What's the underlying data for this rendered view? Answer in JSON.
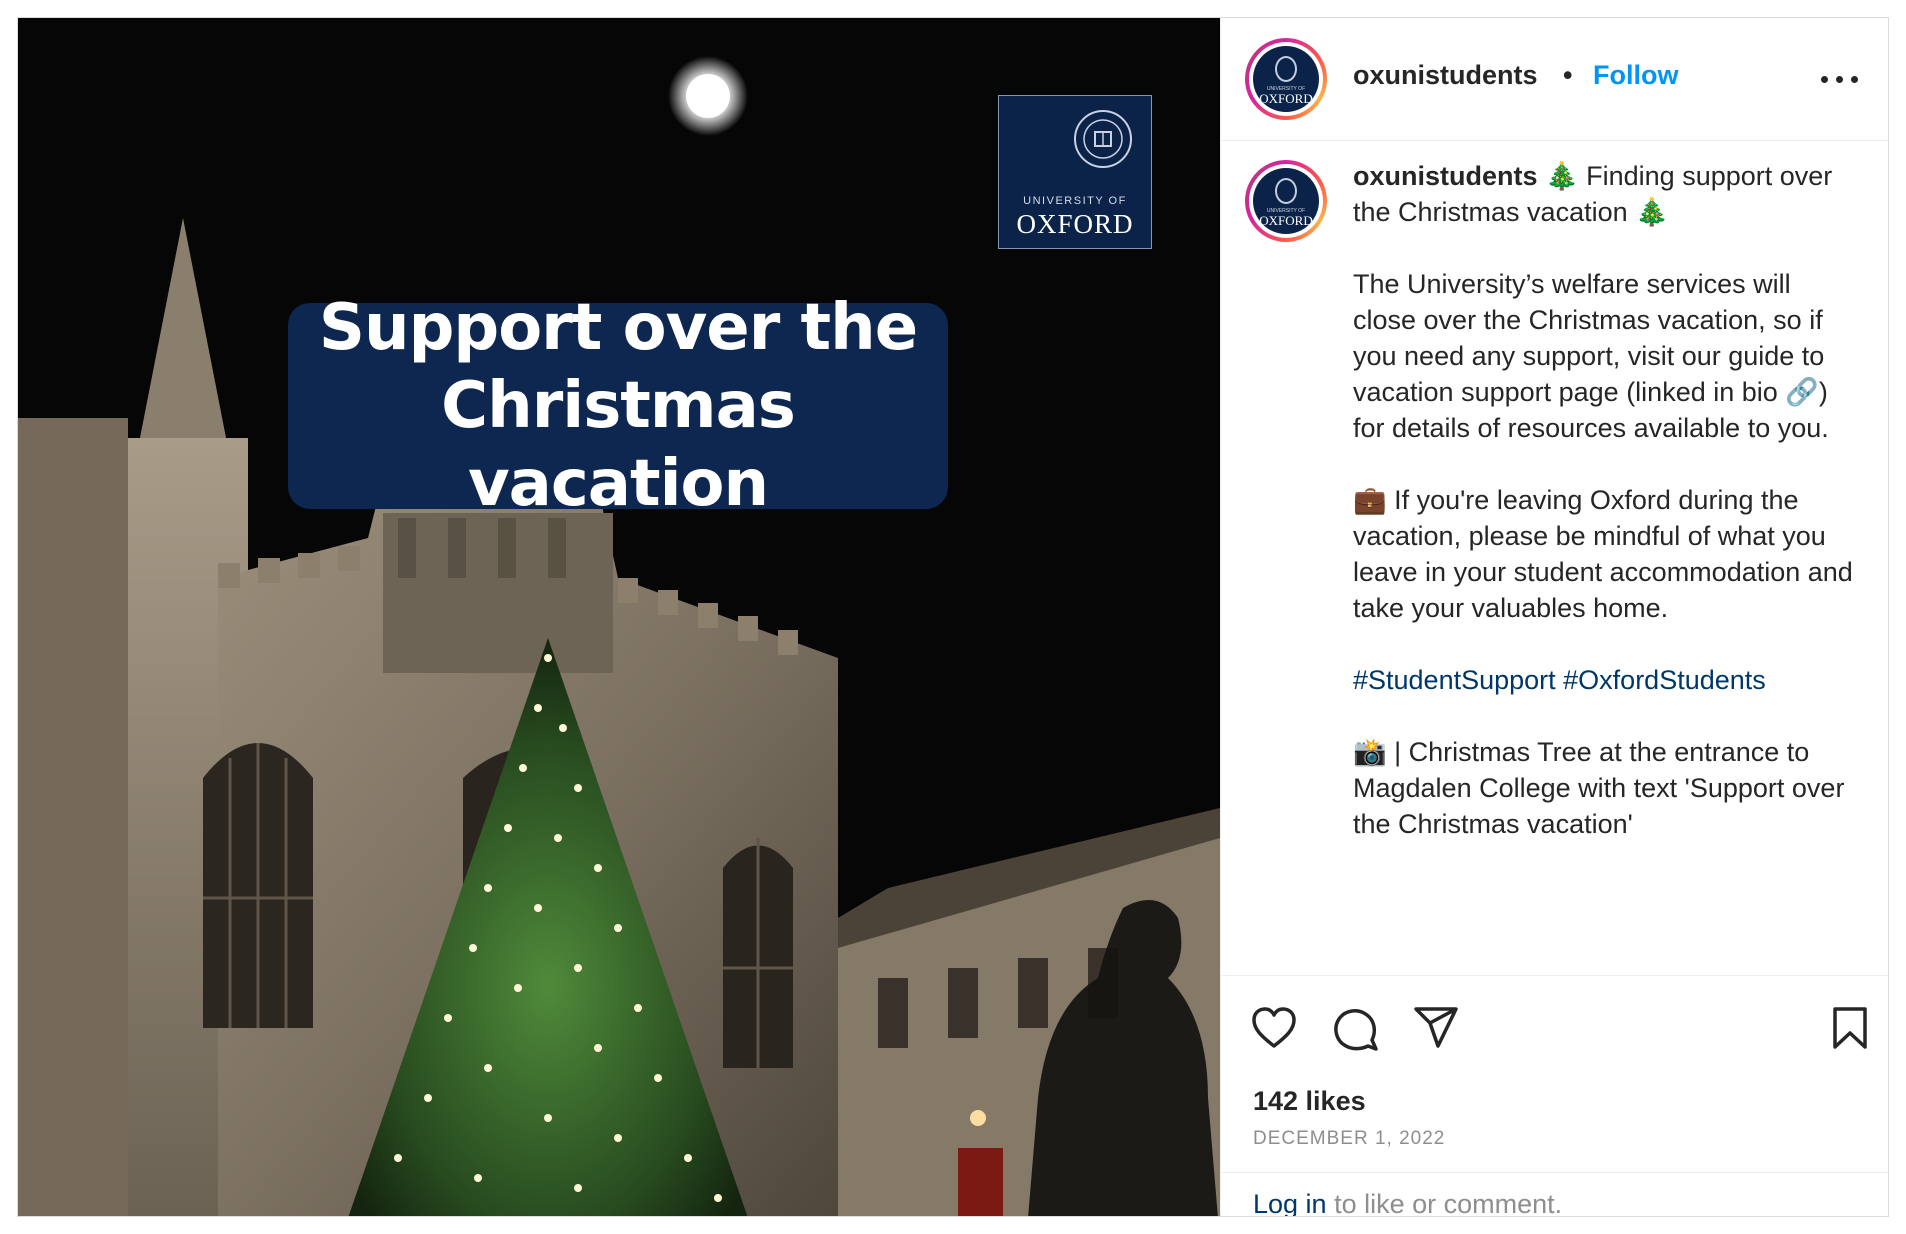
{
  "post": {
    "image": {
      "banner_text": "Support over the\nChristmas vacation",
      "logo_university_of": "UNIVERSITY OF",
      "logo_oxford": "OXFORD"
    },
    "header": {
      "username": "oxunistudents",
      "separator": "•",
      "follow_label": "Follow",
      "more_icon": "more-options-icon"
    },
    "avatar": {
      "university_of": "UNIVERSITY OF",
      "oxford": "OXFORD"
    },
    "caption": {
      "username": "oxunistudents",
      "title": " 🎄 Finding support over the Christmas vacation 🎄",
      "paragraph1": "The University’s welfare services will close over the Christmas vacation, so if you need any support, visit our guide to vacation support page (linked in bio 🔗) for details of resources available to you.",
      "paragraph2": "💼 If you're leaving Oxford during the vacation, please be mindful of what you leave in your student accommodation and take your valuables home.",
      "hashtags": "#StudentSupport #OxfordStudents",
      "paragraph3": "📸 | Christmas Tree at the entrance to Magdalen College with text 'Support over the Christmas vacation'"
    },
    "actions": {
      "icons": [
        "heart-icon",
        "comment-icon",
        "share-icon",
        "bookmark-icon"
      ],
      "likes": "142 likes",
      "date": "DECEMBER 1, 2022",
      "login_link": "Log in",
      "login_suffix": " to like or comment."
    }
  }
}
